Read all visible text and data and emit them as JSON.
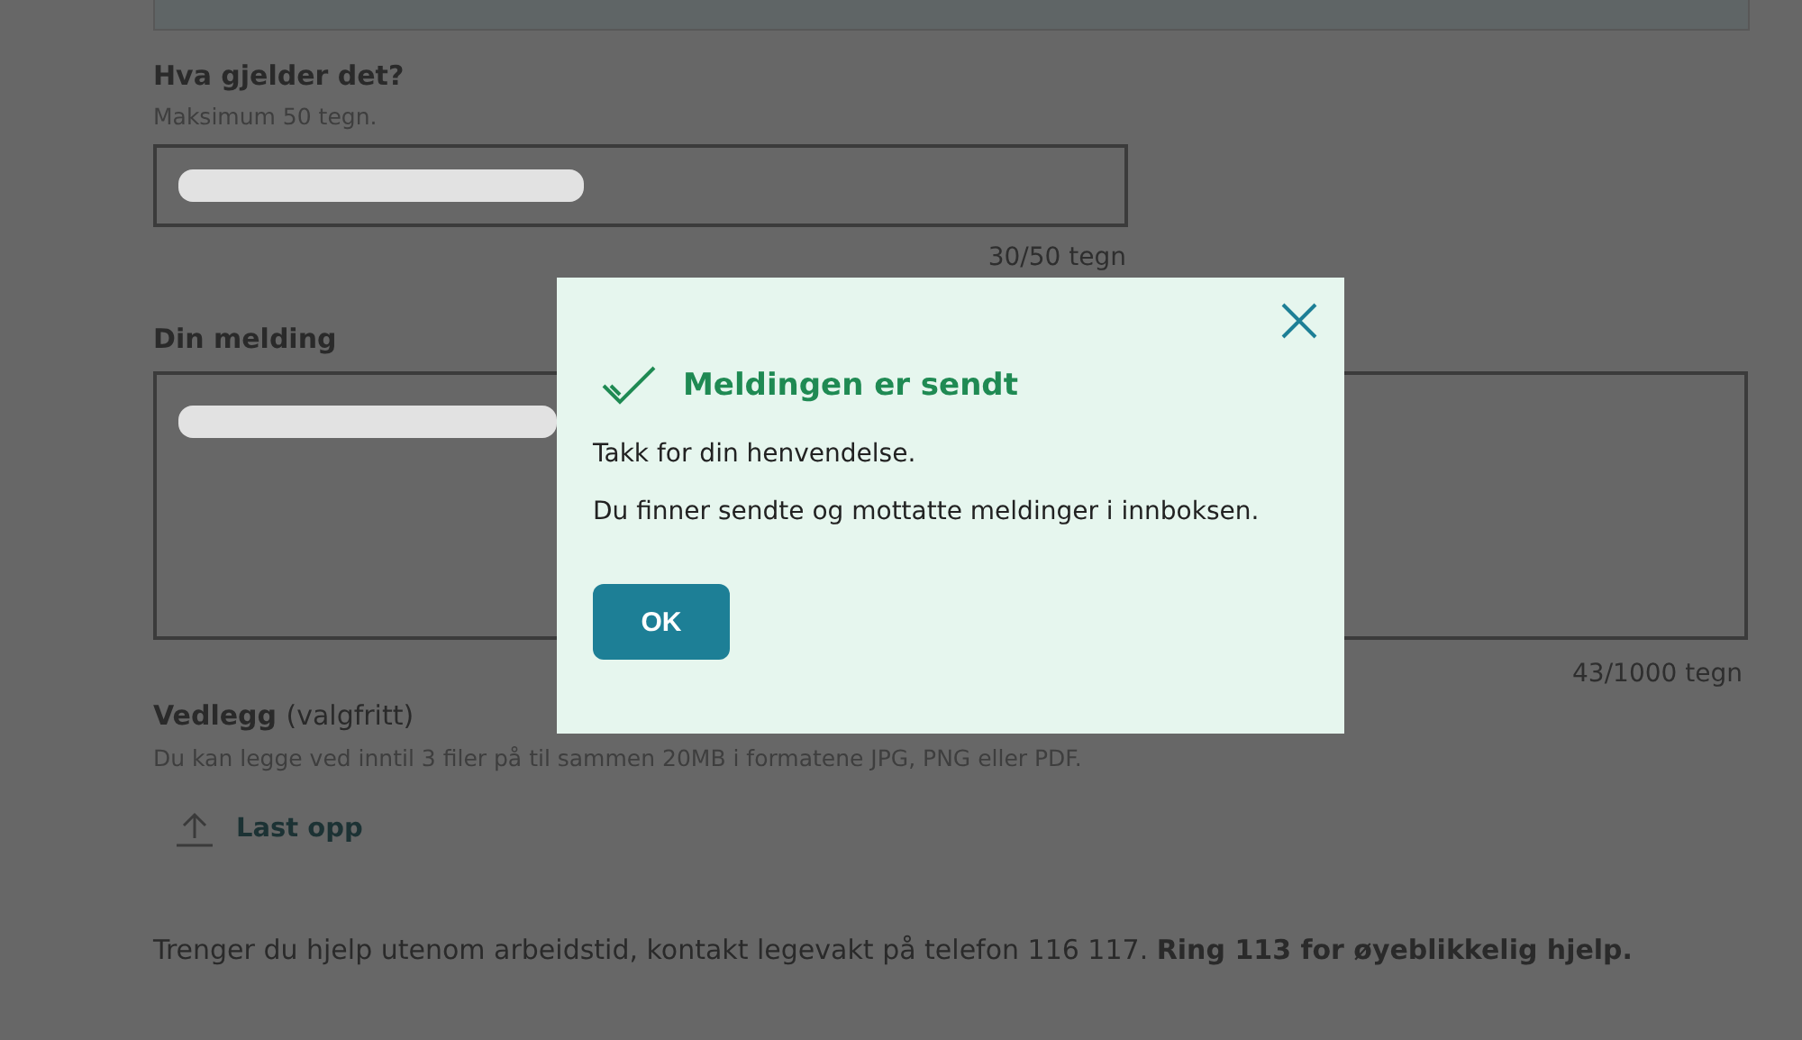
{
  "subject": {
    "label": "Hva gjelder det?",
    "hint": "Maksimum 50 tegn.",
    "counter": "30/50 tegn"
  },
  "message": {
    "label": "Din melding",
    "counter": "43/1000 tegn"
  },
  "attachments": {
    "label": "Vedlegg",
    "optional": "(valgfritt)",
    "hint": "Du kan legge ved inntil 3 filer på til sammen 20MB i formatene JPG, PNG eller PDF.",
    "upload_button": "Last opp"
  },
  "help_text": "Trenger du hjelp utenom arbeidstid, kontakt legevakt på telefon 116 117. **Ring 113 for øyeblikkelig hjelp.**",
  "dialog": {
    "title": "Meldingen er sendt",
    "lines": [
      "Takk for din henvendelse.",
      "Du finner sendte og mottatte meldinger i innboksen."
    ],
    "ok_button": "OK"
  }
}
